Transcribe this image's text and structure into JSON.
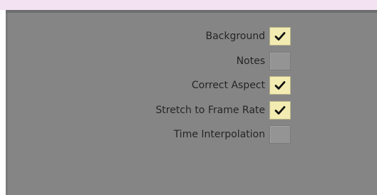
{
  "options": [
    {
      "label": "Background",
      "checked": true
    },
    {
      "label": "Notes",
      "checked": false
    },
    {
      "label": "Correct Aspect",
      "checked": true
    },
    {
      "label": "Stretch to Frame Rate",
      "checked": true
    },
    {
      "label": "Time Interpolation",
      "checked": false
    }
  ],
  "colors": {
    "panel": "#858585",
    "checked_bg": "#f3ecb2",
    "check_mark": "#111111",
    "top_band": "#f2e2f2"
  },
  "icons": {
    "check": "check-icon"
  }
}
